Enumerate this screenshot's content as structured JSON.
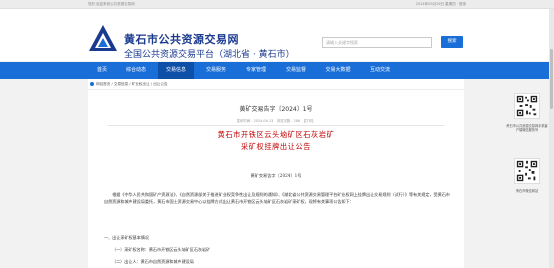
{
  "topbar": {
    "left": "您好,欢迎来到公共资源交易网",
    "right": "2024年09月26日 星期四 · 登录"
  },
  "header": {
    "title": "黄石市公共资源交易网",
    "subtitle": "全国公共资源交易平台（湖北省 · 黄石市）",
    "search_placeholder": "请输入关键字搜索",
    "search_button": "搜索"
  },
  "nav": [
    "首页",
    "综合动态",
    "交易信息",
    "交易服务",
    "专家管理",
    "交易监督",
    "交易大数据",
    "互动交流"
  ],
  "nav_active": 2,
  "breadcrumb": "网站首页 / 交易信息 / 矿业权出让 / 出让公告",
  "announcement": {
    "title": "黄矿交易告字〔2024〕1号",
    "meta": "发布时间：2024-09-13　浏览次数：286　【打印】",
    "doc_title_1": "黄石市开铁区云头垴矿区石灰岩矿",
    "doc_title_2": "采矿权挂牌出让公告",
    "doc_no": "黄矿交易告字〔2024〕1号",
    "paragraph": "根据《中华人民共和国矿产资源法》、《自然资源部关于推进矿业权竞争性出让及规则的通知》、《湖北省公共资源交易管理平台矿业权网上挂牌出让交易规则（试行）》等有关规定，受黄石市自然资源和城乡建设局委托，黄石市国土资源交易中心以挂牌方式出让黄石市开铁区云头垴矿区石灰岩矿采矿权，现将有关事项公告如下：",
    "section_1": "一、出让采矿权基本情况",
    "item_1": "（一）采矿权名称：黄石市开铁区云头垴矿区石灰岩矿",
    "item_2": "（二）出让人：黄石市自然资源和城乡建设局"
  },
  "side": {
    "qr1_caption": "黄石市公共资源交易网手机客户端微信服务号",
    "qr2_caption": "黄石市微信网站"
  },
  "colors": {
    "brand": "#1a3a8f",
    "nav": "#1a6ed8",
    "nav_active": "#0e4fa8",
    "doc_title": "#c00000"
  }
}
